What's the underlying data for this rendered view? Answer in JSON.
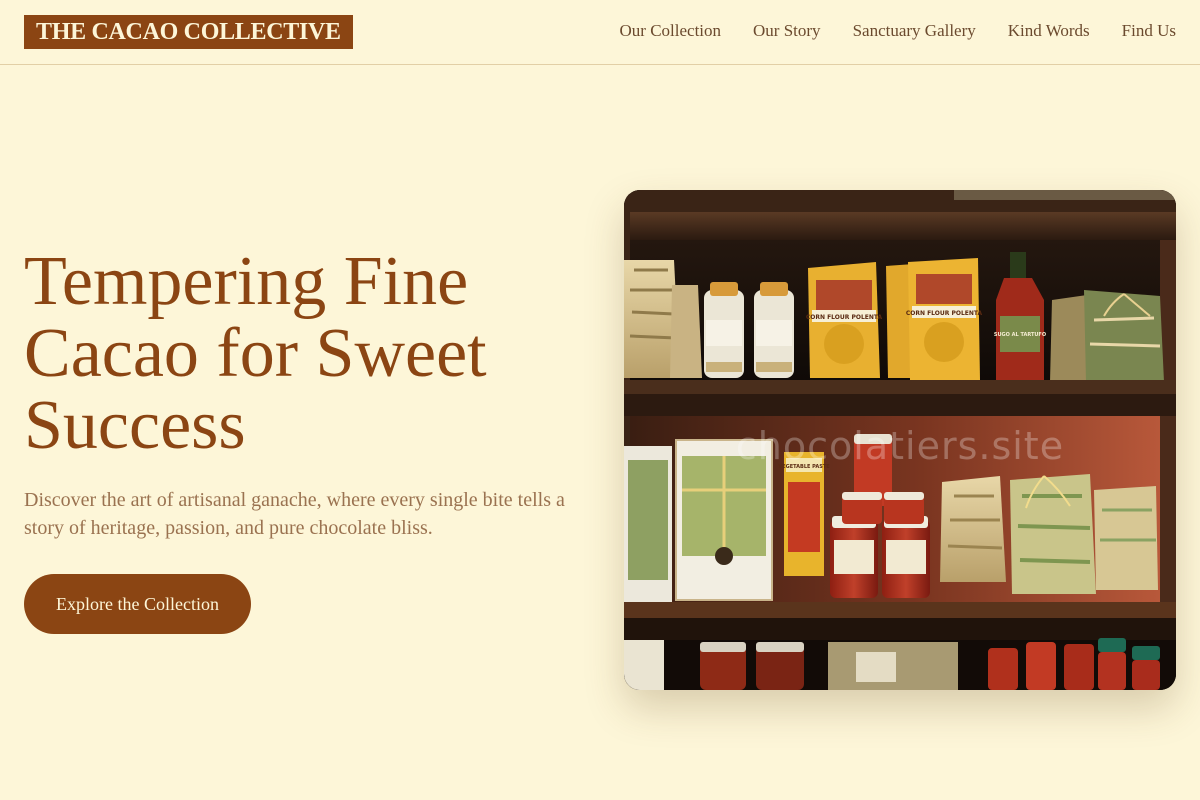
{
  "brand": {
    "name": "THE CACAO COLLECTIVE"
  },
  "nav": {
    "items": [
      {
        "label": "Our Collection"
      },
      {
        "label": "Our Story"
      },
      {
        "label": "Sanctuary Gallery"
      },
      {
        "label": "Kind Words"
      },
      {
        "label": "Find Us"
      }
    ]
  },
  "hero": {
    "title": "Tempering Fine Cacao for Sweet Success",
    "subtitle": "Discover the art of artisanal ganache, where every single bite tells a story of heritage, passion, and pure chocolate bliss.",
    "cta_label": "Explore the Collection"
  },
  "photo": {
    "watermark": "chocolatiers.site",
    "labels": {
      "polenta": "CORN FLOUR POLENTA",
      "sugo": "SUGO AL TARTUFO",
      "paste": "VEGETABLE PASTE"
    }
  },
  "colors": {
    "background": "#fdf6d8",
    "brand": "#8b4513",
    "text_muted": "#9a7250",
    "nav_text": "#6b4a2e"
  }
}
